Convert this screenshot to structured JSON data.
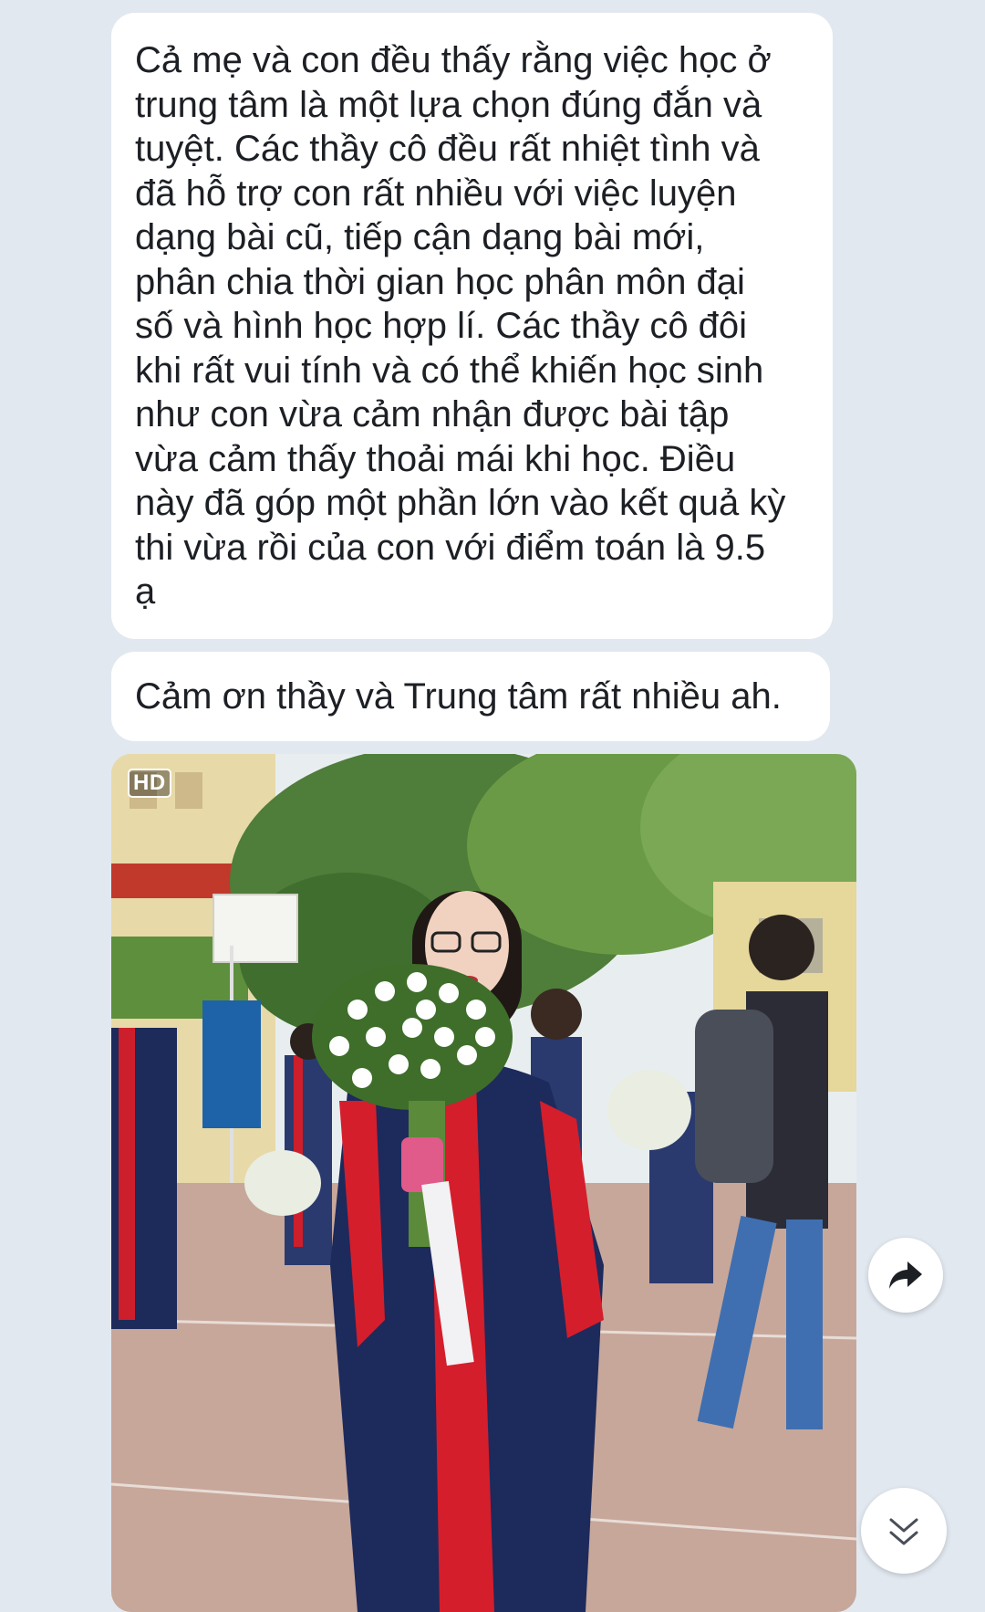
{
  "messages": [
    {
      "lines": [
        "Cả mẹ và con đều thấy rằng việc học ở",
        "trung tâm là một lựa chọn đúng đắn và",
        "tuyệt. Các thầy cô đều rất nhiệt tình và",
        "đã hỗ trợ con rất nhiều với việc luyện",
        "dạng bài cũ, tiếp cận dạng bài mới,",
        "phân chia thời gian học phân môn đại",
        "số và hình học hợp lí. Các thầy cô đôi",
        "khi rất vui tính và có thể khiến học sinh",
        "như con vừa cảm nhận được bài tập",
        "vừa cảm thấy thoải mái khi học. Điều",
        "này đã góp một phần lớn vào kết quả kỳ",
        "thi vừa rồi của con  với điểm toán là 9.5",
        "ạ"
      ]
    },
    {
      "text": "Cảm ơn thầy và Trung tâm rất nhiều ah."
    }
  ],
  "photo": {
    "badge": "HD"
  },
  "icons": {
    "share": "share-arrow-icon",
    "scroll_down": "double-chevron-down-icon"
  },
  "colors": {
    "background": "#e2e8f0",
    "bubble": "#ffffff",
    "text": "#1c1f24"
  }
}
